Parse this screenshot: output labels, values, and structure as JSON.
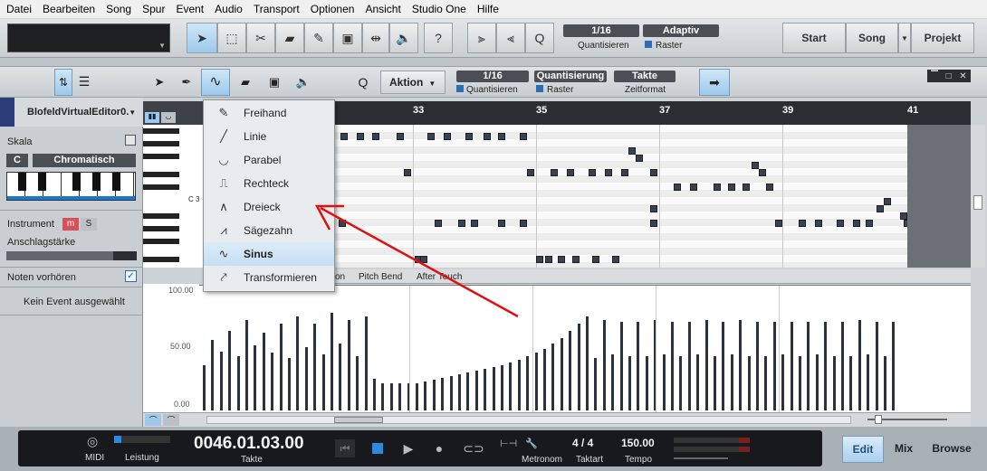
{
  "menu": [
    "Datei",
    "Bearbeiten",
    "Song",
    "Spur",
    "Event",
    "Audio",
    "Transport",
    "Optionen",
    "Ansicht",
    "Studio One",
    "Hilfe"
  ],
  "toolbar": {
    "quantize_value": "1/16",
    "quantize_label": "Quantisieren",
    "raster_value": "Adaptiv",
    "raster_label": "Raster",
    "start_label": "Start",
    "song_label": "Song",
    "projekt_label": "Projekt",
    "help_label": "?",
    "q_label": "Q"
  },
  "editor_bar": {
    "aktion_label": "Aktion",
    "quant_value": "1/16",
    "quant_label": "Quantisieren",
    "quantisierung_btn": "Quantisierung",
    "raster_label": "Raster",
    "takte_btn": "Takte",
    "zeitformat_label": "Zeitformat",
    "q_label": "Q"
  },
  "left_panel": {
    "instrument_name": "BlofeldVirtualEditor0.",
    "skala_label": "Skala",
    "key_value": "C",
    "scale_value": "Chromatisch",
    "instrument_label": "Instrument",
    "m_label": "m",
    "s_label": "S",
    "velocity_label": "Anschlagstärke",
    "preview_label": "Noten vorhören",
    "no_event_label": "Kein Event ausgewählt",
    "c3_label": "C 3"
  },
  "ruler": [
    "33",
    "35",
    "37",
    "39",
    "41"
  ],
  "lane_tabs": [
    "on",
    "Pitch Bend",
    "After Touch"
  ],
  "velocity_axis": [
    "100.00",
    "50.00",
    "0.00"
  ],
  "dropdown": {
    "items": [
      {
        "icon": "✎",
        "label": "Freihand"
      },
      {
        "icon": "╱",
        "label": "Linie"
      },
      {
        "icon": "◡",
        "label": "Parabel"
      },
      {
        "icon": "⎍",
        "label": "Rechteck"
      },
      {
        "icon": "∧",
        "label": "Dreieck"
      },
      {
        "icon": "⩘",
        "label": "Sägezahn"
      },
      {
        "icon": "∿",
        "label": "Sinus"
      },
      {
        "icon": "⤤",
        "label": "Transformieren"
      }
    ],
    "selected_index": 6
  },
  "transport": {
    "midi_label": "MIDI",
    "leistung_label": "Leistung",
    "position": "0046.01.03.00",
    "takte_label": "Takte",
    "metronom_label": "Metronom",
    "taktart_value": "4 / 4",
    "taktart_label": "Taktart",
    "tempo_value": "150.00",
    "tempo_label": "Tempo",
    "edit_label": "Edit",
    "mix_label": "Mix",
    "browse_label": "Browse"
  },
  "colors": {
    "accent_blue": "#9cc9ec",
    "note": "#3b4150",
    "arrow": "#e01010"
  }
}
